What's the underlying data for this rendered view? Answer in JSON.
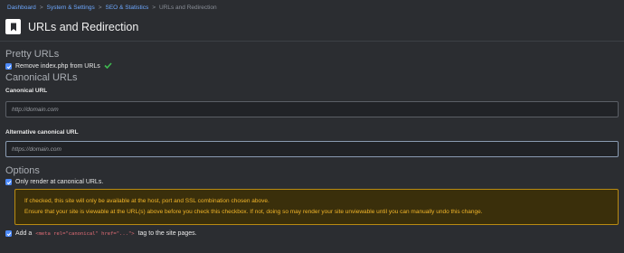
{
  "breadcrumb": [
    {
      "label": "Dashboard",
      "link": true
    },
    {
      "label": "System & Settings",
      "link": true
    },
    {
      "label": "SEO & Statistics",
      "link": true
    },
    {
      "label": "URLs and Redirection",
      "link": false
    }
  ],
  "breadcrumb_sep": ">",
  "page": {
    "title": "URLs and Redirection",
    "icon": "bookmark-icon"
  },
  "pretty_urls": {
    "title": "Pretty URLs",
    "remove_index": {
      "label": "Remove index.php from URLs",
      "checked": true,
      "status_icon": "check-icon"
    }
  },
  "canonical": {
    "title": "Canonical URLs",
    "canonical_label": "Canonical URL",
    "canonical_placeholder": "http://domain.com",
    "alt_label": "Alternative canonical URL",
    "alt_placeholder": "https://domain.com"
  },
  "options": {
    "title": "Options",
    "only_render": {
      "label": "Only render at canonical URLs.",
      "checked": true
    },
    "warning_line1": "If checked, this site will only be available at the host, port and SSL combination chosen above.",
    "warning_line2": "Ensure that your site is viewable at the URL(s) above before you check this checkbox. If not, doing so may render your site unviewable until you can manually undo this change.",
    "add_meta": {
      "prefix": "Add a",
      "code": "<meta rel=\"canonical\" href=\"...\">",
      "suffix": "tag to the site pages.",
      "checked": true
    }
  },
  "colors": {
    "accent": "#4e8cff",
    "success": "#3fb950",
    "warning_text": "#f0b429",
    "warning_border": "#b98b12"
  }
}
